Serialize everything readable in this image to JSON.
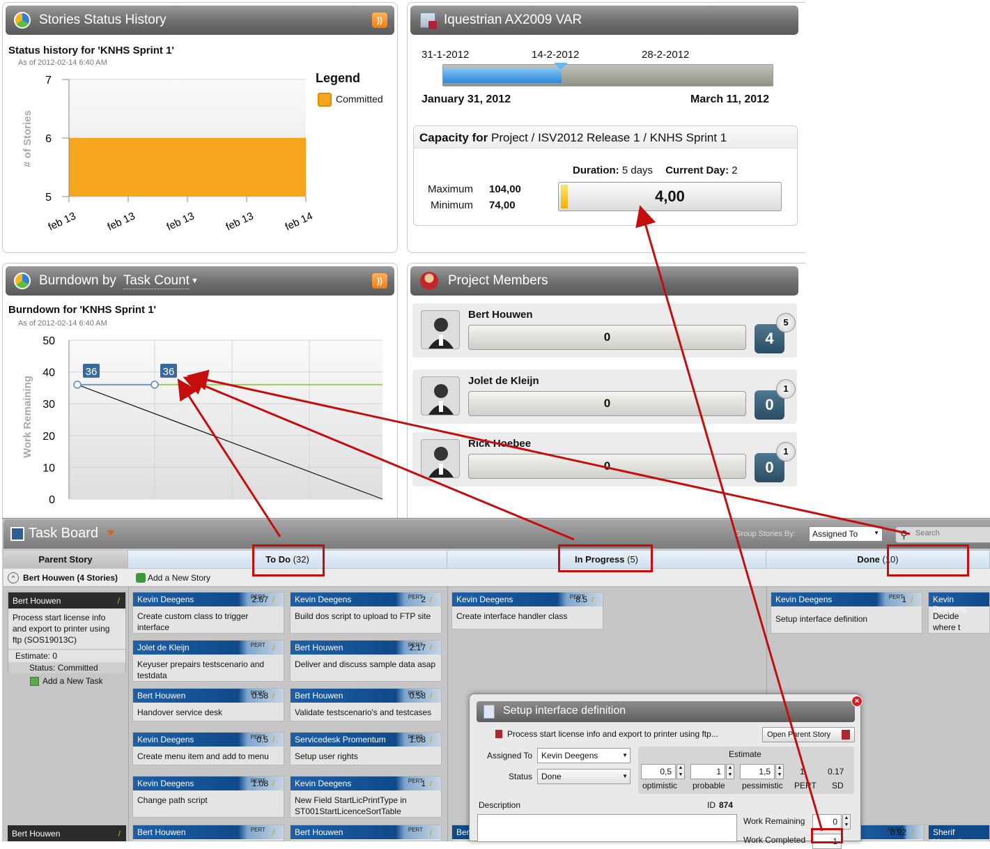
{
  "stories_status": {
    "title": "Stories Status History",
    "chart_title": "Status history for 'KNHS Sprint 1'",
    "as_of": "As of 2012-02-14 6:40 AM",
    "legend_title": "Legend",
    "legend_item": "Committed",
    "ylabel": "# of Stories"
  },
  "chart_data": [
    {
      "type": "area",
      "title": "Status history for 'KNHS Sprint 1'",
      "ylabel": "# of Stories",
      "categories": [
        "feb 13",
        "feb 13",
        "feb 13",
        "feb 13",
        "feb 14"
      ],
      "series": [
        {
          "name": "Committed",
          "values": [
            6,
            6,
            6,
            6,
            6
          ]
        }
      ],
      "ylim": [
        5,
        7
      ],
      "yticks": [
        7,
        6,
        5
      ],
      "colors": {
        "Committed": "#f6a51f"
      },
      "legend": "right"
    },
    {
      "type": "line",
      "title": "Burndown for 'KNHS Sprint 1'",
      "ylabel": "Work Remaining",
      "ylim": [
        0,
        50
      ],
      "yticks": [
        50,
        40,
        30,
        20,
        10,
        0
      ],
      "x": [
        0,
        1,
        2,
        3,
        4
      ],
      "series": [
        {
          "values": [
            36,
            36
          ]
        },
        {
          "values": [
            36,
            0
          ]
        },
        {
          "values": [
            36,
            36,
            36,
            36
          ]
        }
      ],
      "labels": [
        "36",
        "36"
      ]
    }
  ],
  "burndown": {
    "title_prefix": "Burndown by",
    "title_select": "Task Count",
    "chart_title": "Burndown for 'KNHS Sprint 1'",
    "as_of": "As of 2012-02-14 6:40 AM",
    "ylabel": "Work Remaining",
    "label1": "36",
    "label2": "36"
  },
  "project": {
    "title": "Iquestrian AX2009 VAR",
    "dates": [
      "31-1-2012",
      "14-2-2012",
      "28-2-2012"
    ],
    "start": "January 31, 2012",
    "end": "March 11, 2012",
    "timeline_progress": 0.36,
    "capacity_label": "Capacity for",
    "capacity_path": "Project / ISV2012 Release 1 / KNHS Sprint 1",
    "duration_label": "Duration:",
    "duration_value": "5 days",
    "current_day_label": "Current Day:",
    "current_day_value": "2",
    "maximum_label": "Maximum",
    "maximum_value": "104,00",
    "minimum_label": "Minimum",
    "minimum_value": "74,00",
    "capacity_value": "4,00"
  },
  "members": {
    "title": "Project Members",
    "list": [
      {
        "name": "Bert Houwen",
        "bar": "0",
        "count": "4",
        "badge": "5"
      },
      {
        "name": "Jolet de Kleijn",
        "bar": "0",
        "count": "0",
        "badge": "1"
      },
      {
        "name": "Rick Hoebee",
        "bar": "0",
        "count": "0",
        "badge": "1"
      }
    ]
  },
  "taskboard": {
    "title": "Task Board",
    "group_label": "Group Stories By:",
    "group_value": "Assigned To",
    "search_placeholder": "Search",
    "col_parent": "Parent Story",
    "col_todo": "To Do",
    "col_todo_count": "(32)",
    "col_progress": "In Progress",
    "col_progress_count": "(5)",
    "col_done": "Done",
    "col_done_count": "(10)",
    "group_title": "Bert Houwen (4 Stories)",
    "add_story": "Add a New Story",
    "story": {
      "owner": "Bert Houwen",
      "text": "Process start license info and export to printer using ftp (SOS19013C)",
      "estimate": "Estimate: 0",
      "status": "Status: Committed",
      "add_task": "Add a New Task"
    },
    "story2_owner": "Bert Houwen",
    "pert": "PERT",
    "todo_tasks": [
      {
        "owner": "Kevin Deegens",
        "pert": "2.67",
        "text": "Create custom class to trigger interface"
      },
      {
        "owner": "Kevin Deegens",
        "pert": "2",
        "text": "Build dos script to upload to FTP site"
      },
      {
        "owner": "Jolet de Kleijn",
        "pert": "",
        "text": "Keyuser prepairs testscenario and testdata"
      },
      {
        "owner": "Bert Houwen",
        "pert": "2.17",
        "text": "Deliver and discuss sample data asap"
      },
      {
        "owner": "Bert Houwen",
        "pert": "0.58",
        "text": "Handover service desk"
      },
      {
        "owner": "Bert Houwen",
        "pert": "0.58",
        "text": "Validate testscenario's and testcases"
      },
      {
        "owner": "Kevin Deegens",
        "pert": "0.5",
        "text": "Create menu item and add to menu"
      },
      {
        "owner": "Servicedesk Promentum",
        "pert": "1.08",
        "text": "Setup user rights"
      },
      {
        "owner": "Kevin Deegens",
        "pert": "1.08",
        "text": "Change path script"
      },
      {
        "owner": "Kevin Deegens",
        "pert": "1",
        "text": "New Field StartLicPrintType in ST001StartLicenceSortTable"
      }
    ],
    "row2_tasks": [
      {
        "owner": "Bert Houwen",
        "pert": ""
      },
      {
        "owner": "Bert Houwen",
        "pert": ""
      }
    ],
    "progress_task": {
      "owner": "Kevin Deegens",
      "pert": "8.5",
      "text": "Create interface handler class"
    },
    "done_tasks": [
      {
        "owner": "Kevin Deegens",
        "pert": "1",
        "text": "Setup interface definition"
      },
      {
        "owner": "Kevin Deegens",
        "pert": "",
        "text": "Decide where t KNHS Share"
      }
    ],
    "row2_progress_owner": "Bert",
    "row2_done_pert": "0.92",
    "row2_done_owner": "Sherif Metwally"
  },
  "dialog": {
    "title": "Setup interface definition",
    "parent": "Process start license info and export to printer using ftp...",
    "open_parent": "Open Parent Story",
    "assigned_label": "Assigned To",
    "assigned_value": "Kevin Deegens",
    "status_label": "Status",
    "status_value": "Done",
    "estimate_label": "Estimate",
    "optimistic_value": "0,5",
    "probable_value": "1",
    "pessimistic_value": "1,5",
    "pert_value": "1",
    "sd_value": "0.17",
    "optimistic_label": "optimistic",
    "probable_label": "probable",
    "pessimistic_label": "pessimistic",
    "pert_label": "PERT",
    "sd_label": "SD",
    "description_label": "Description",
    "id_label": "ID",
    "id_value": "874",
    "work_remaining_label": "Work Remaining",
    "work_remaining_value": "0",
    "work_completed_label": "Work Completed",
    "work_completed_value": "1"
  }
}
